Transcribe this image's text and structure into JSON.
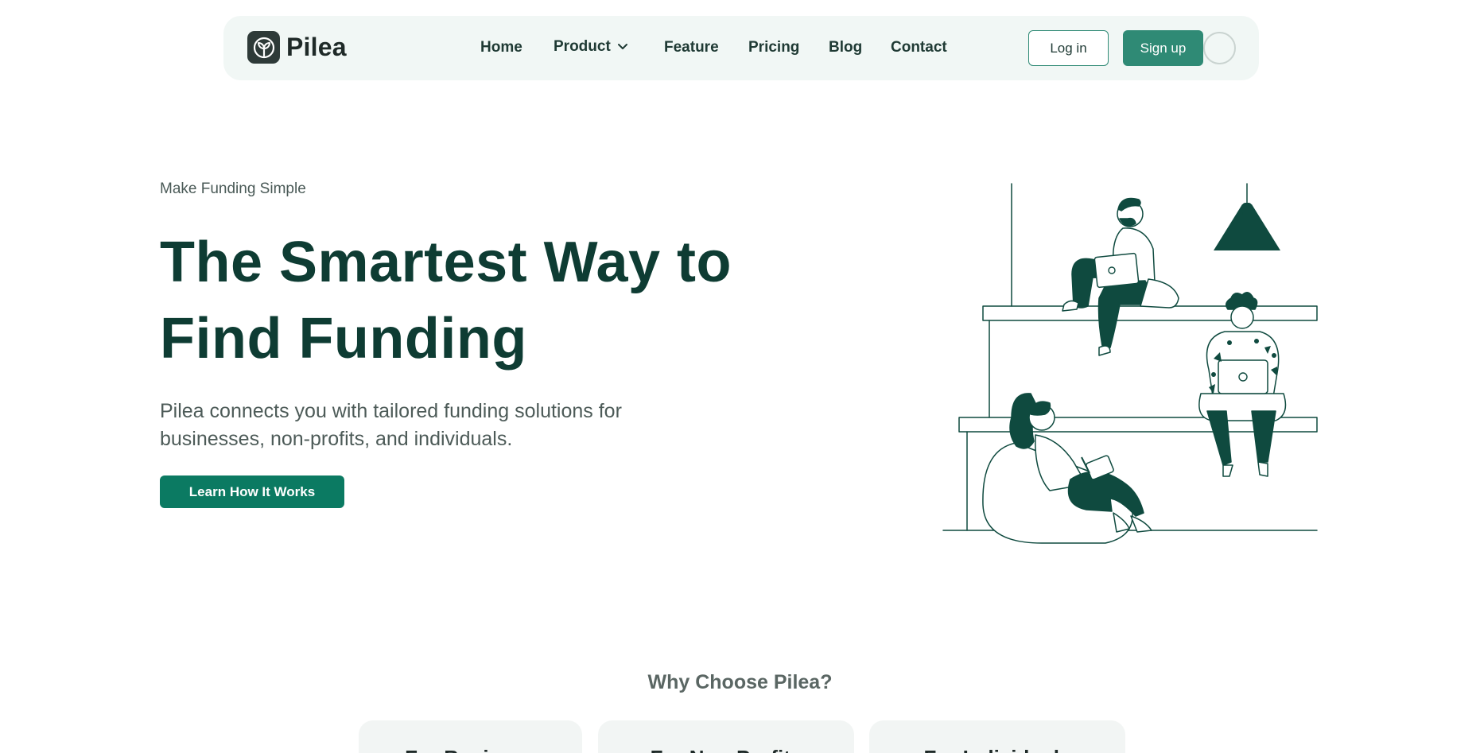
{
  "brand": {
    "name": "Pilea",
    "icon": "leaf-logo-icon"
  },
  "nav": {
    "links": [
      "Home",
      "Product",
      "Feature",
      "Pricing",
      "Blog",
      "Contact"
    ],
    "product_dropdown_icon": "chevron-down-icon",
    "login_label": "Log in",
    "signup_label": "Sign up"
  },
  "hero": {
    "eyebrow": "Make Funding Simple",
    "title_line1": "The Smartest Way to",
    "title_line2": "Find Funding",
    "description": "Pilea connects you with tailored funding solutions for businesses, non-profits, and individuals.",
    "cta_label": "Learn How It Works",
    "illustration": "people-working-on-laptops-illustration"
  },
  "why": {
    "title": "Why Choose Pilea?",
    "cards": [
      "For Business",
      "For Non-Profits",
      "For Individuals"
    ]
  },
  "colors": {
    "primary": "#0b7a62",
    "accent": "#2f8a75",
    "heading": "#0e3c33",
    "nav_bg": "#f1f7f5",
    "illustration_fill": "#0f4a3f"
  }
}
